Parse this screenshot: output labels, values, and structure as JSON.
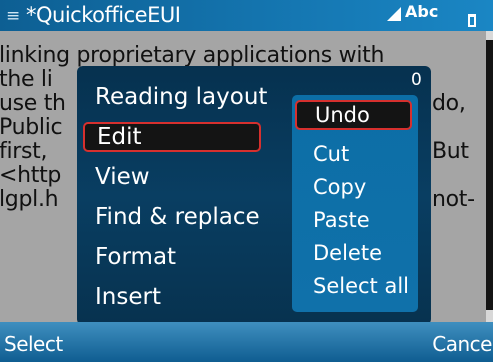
{
  "status_bar": {
    "title": "*QuickofficeEUI",
    "input_mode": "Abc",
    "app_icon": "document-icon",
    "signal_icon": "signal-icon",
    "battery_icon": "battery-icon"
  },
  "document": {
    "lines": [
      "linking proprietary applications with",
      "the li",
      "use th",
      "Public",
      "first, ",
      "<http",
      "lgpl.h"
    ],
    "right_fragments": [
      "do,",
      "But",
      "not-"
    ]
  },
  "menu": {
    "flag": "0",
    "items": [
      {
        "label": "Reading layout"
      },
      {
        "label": "Edit"
      },
      {
        "label": "View"
      },
      {
        "label": "Find & replace"
      },
      {
        "label": "Format"
      },
      {
        "label": "Insert"
      }
    ],
    "selected_index": 1
  },
  "submenu": {
    "items": [
      {
        "label": "Undo"
      },
      {
        "label": "Cut"
      },
      {
        "label": "Copy"
      },
      {
        "label": "Paste"
      },
      {
        "label": "Delete"
      },
      {
        "label": "Select all"
      }
    ],
    "selected_index": 0
  },
  "softkeys": {
    "left": "Select",
    "right": "Cancel"
  },
  "colors": {
    "status_bar": "#1577b2",
    "menu_bg": "#093e62",
    "submenu_bg": "#0c6ea6",
    "highlight_border": "#d6302e",
    "highlight_bg": "#141414"
  }
}
